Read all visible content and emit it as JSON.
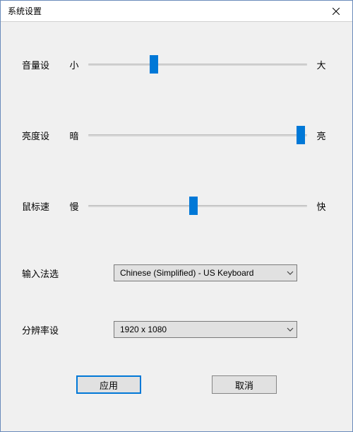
{
  "window": {
    "title": "系统设置"
  },
  "sliders": {
    "volume": {
      "label": "音量设",
      "min_label": "小",
      "max_label": "大",
      "percent": 30
    },
    "brightness": {
      "label": "亮度设",
      "min_label": "暗",
      "max_label": "亮",
      "percent": 97
    },
    "mouse": {
      "label": "鼠标速",
      "min_label": "慢",
      "max_label": "快",
      "percent": 48
    }
  },
  "selects": {
    "ime": {
      "label": "输入法选",
      "value": "Chinese (Simplified) - US Keyboard"
    },
    "resolution": {
      "label": "分辨率设",
      "value": "1920 x 1080"
    }
  },
  "buttons": {
    "apply": "应用",
    "cancel": "取消"
  }
}
